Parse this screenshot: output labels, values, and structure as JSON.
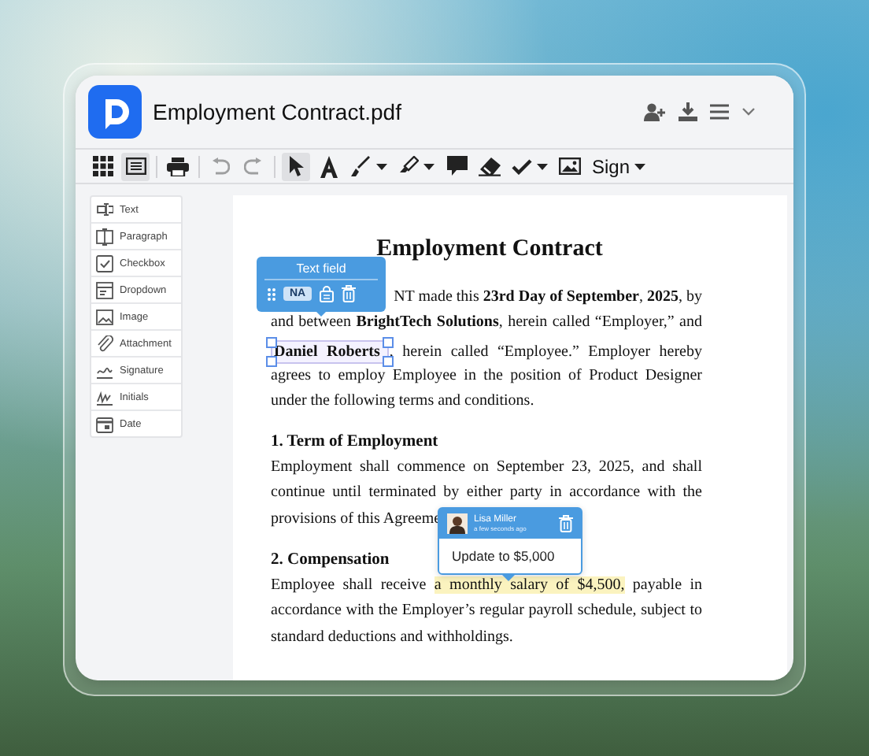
{
  "window": {
    "title": "Employment Contract.pdf"
  },
  "header_actions": [
    {
      "kind": "add-user"
    },
    {
      "kind": "download"
    },
    {
      "kind": "menu"
    },
    {
      "kind": "chevron"
    }
  ],
  "toolbar": [
    {
      "kind": "grid",
      "selected": false,
      "disabled": false,
      "caret": false
    },
    {
      "kind": "list",
      "selected": true,
      "disabled": false,
      "caret": false
    },
    {
      "kind": "sep"
    },
    {
      "kind": "print",
      "selected": false,
      "disabled": false,
      "caret": false
    },
    {
      "kind": "sep"
    },
    {
      "kind": "undo",
      "selected": false,
      "disabled": true,
      "caret": false
    },
    {
      "kind": "redo",
      "selected": false,
      "disabled": true,
      "caret": false
    },
    {
      "kind": "sep"
    },
    {
      "kind": "pointer",
      "selected": true,
      "disabled": false,
      "caret": false
    },
    {
      "kind": "text",
      "selected": false,
      "disabled": false,
      "caret": false
    },
    {
      "kind": "pen",
      "selected": false,
      "disabled": false,
      "caret": true
    },
    {
      "kind": "highlighter",
      "selected": false,
      "disabled": false,
      "caret": true
    },
    {
      "kind": "comment",
      "selected": false,
      "disabled": false,
      "caret": false
    },
    {
      "kind": "eraser",
      "selected": false,
      "disabled": false,
      "caret": false
    },
    {
      "kind": "check",
      "selected": false,
      "disabled": false,
      "caret": true
    },
    {
      "kind": "image",
      "selected": false,
      "disabled": false,
      "caret": false
    },
    {
      "kind": "label",
      "label": "Sign",
      "selected": false,
      "disabled": false,
      "caret": true
    }
  ],
  "sidebar": {
    "items": [
      {
        "kind": "text",
        "label": "Text"
      },
      {
        "kind": "paragraph",
        "label": "Paragraph"
      },
      {
        "kind": "checkbox",
        "label": "Checkbox"
      },
      {
        "kind": "dropdown",
        "label": "Dropdown"
      },
      {
        "kind": "image",
        "label": "Image"
      },
      {
        "kind": "attachment",
        "label": "Attachment"
      },
      {
        "kind": "signature",
        "label": "Signature"
      },
      {
        "kind": "initials",
        "label": "Initials"
      },
      {
        "kind": "date",
        "label": "Date"
      }
    ]
  },
  "document": {
    "title": "Employment Contract",
    "blocks": [
      {
        "kind": "paragraph",
        "lines": [
          {
            "kind": "tail",
            "segments": [
              {
                "kind": "text",
                "text": "NT made this **23rd Day of September**, **2025**, by"
              }
            ]
          },
          {
            "kind": "full",
            "segments": [
              {
                "kind": "text",
                "text": "and between **BrightTech Solutions**, herein called “Employer,” and"
              }
            ]
          },
          {
            "kind": "full",
            "segments": [
              {
                "kind": "field",
                "text": "Daniel Roberts"
              },
              {
                "kind": "text",
                "text": ", herein called “Employee.” Employer hereby"
              }
            ]
          },
          {
            "kind": "full",
            "segments": [
              {
                "kind": "text",
                "text": "agrees to employ Employee in the position of Product Designer"
              }
            ]
          },
          {
            "kind": "end",
            "segments": [
              {
                "kind": "text",
                "text": "under the following terms and conditions."
              }
            ]
          }
        ]
      },
      {
        "kind": "heading",
        "text": "1. Term of Employment"
      },
      {
        "kind": "paragraph",
        "lines": [
          {
            "kind": "full",
            "segments": [
              {
                "kind": "text",
                "text": "Employment shall commence on September 23, 2025, and shall"
              }
            ]
          },
          {
            "kind": "full",
            "segments": [
              {
                "kind": "text",
                "text": "continue until terminated by either party in accordance with the"
              }
            ]
          },
          {
            "kind": "end",
            "segments": [
              {
                "kind": "text",
                "text": "provisions of this Agreeme"
              }
            ]
          }
        ]
      },
      {
        "kind": "heading",
        "text": "2. Compensation"
      },
      {
        "kind": "paragraph",
        "lines": [
          {
            "kind": "full",
            "segments": [
              {
                "kind": "text",
                "text": "Employee shall receive "
              },
              {
                "kind": "highlight",
                "text": "a monthly salary of  $4,500,"
              },
              {
                "kind": "text",
                "text": " payable in"
              }
            ]
          },
          {
            "kind": "full",
            "segments": [
              {
                "kind": "text",
                "text": "accordance with the Employer’s regular payroll schedule, subject to"
              }
            ]
          },
          {
            "kind": "end",
            "segments": [
              {
                "kind": "text",
                "text": "standard deductions and withholdings."
              }
            ]
          }
        ]
      }
    ]
  },
  "field_popup": {
    "title": "Text field",
    "chip": "NA"
  },
  "comment": {
    "author": "Lisa Miller",
    "time": "a few seconds ago",
    "text": "Update to $5,000"
  }
}
